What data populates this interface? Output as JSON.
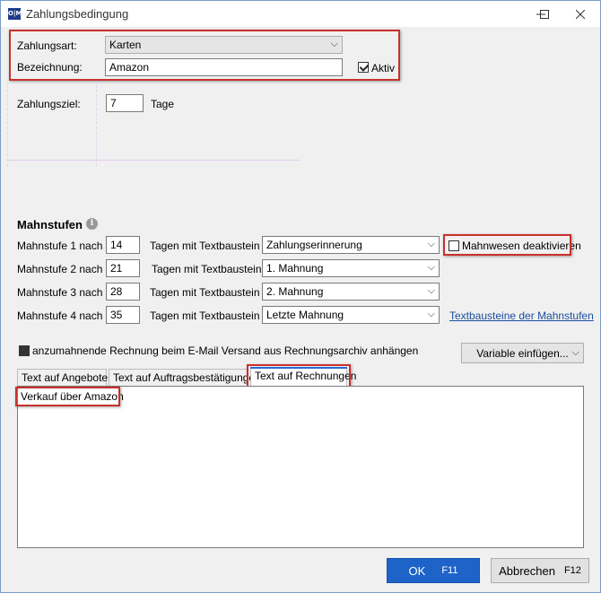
{
  "window": {
    "title": "Zahlungsbedingung",
    "icon_text": "O|M"
  },
  "form": {
    "zahlungsart_label": "Zahlungsart:",
    "zahlungsart_value": "Karten",
    "bezeichnung_label": "Bezeichnung:",
    "bezeichnung_value": "Amazon",
    "aktiv_label": "Aktiv",
    "aktiv_checked": true,
    "zahlungsziel_label": "Zahlungsziel:",
    "zahlungsziel_value": "7",
    "zahlungsziel_unit": "Tage"
  },
  "mahnstufen": {
    "heading": "Mahnstufen",
    "rows": [
      {
        "label": "Mahnstufe 1 nach",
        "days": "14",
        "middle": "Tagen mit Textbaustein",
        "baustein": "Zahlungserinnerung"
      },
      {
        "label": "Mahnstufe 2 nach",
        "days": "21",
        "middle": "Tagen mit Textbaustein",
        "baustein": "1. Mahnung"
      },
      {
        "label": "Mahnstufe 3 nach",
        "days": "28",
        "middle": "Tagen mit Textbaustein",
        "baustein": "2. Mahnung"
      },
      {
        "label": "Mahnstufe 4 nach",
        "days": "35",
        "middle": "Tagen mit Textbaustein",
        "baustein": "Letzte Mahnung"
      }
    ],
    "mahnwesen_label": "Mahnwesen deaktivieren",
    "textbausteine_link": "Textbausteine der Mahnstufen"
  },
  "attach": {
    "label": "anzumahnende Rechnung beim E-Mail Versand aus Rechnungsarchiv anhängen",
    "variable_button": "Variable einfügen..."
  },
  "tabs": [
    {
      "label": "Text auf Angeboten"
    },
    {
      "label": "Text auf Auftragsbestätigungen"
    },
    {
      "label": "Text auf Rechnungen"
    }
  ],
  "text_content": "Verkauf über Amazon",
  "buttons": {
    "ok_label": "OK",
    "ok_shortcut": "F11",
    "cancel_label": "Abbrechen",
    "cancel_shortcut": "F12"
  }
}
